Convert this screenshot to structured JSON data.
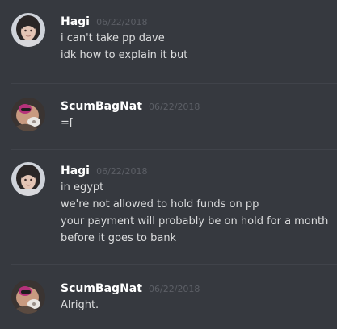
{
  "colors": {
    "background": "#36393f",
    "username": "#ffffff",
    "message_text": "#dcddde",
    "timestamp": "#5c5f66",
    "divider": "#40434a"
  },
  "messages": [
    {
      "username": "Hagi",
      "timestamp": "06/22/2018",
      "avatar": "hagi-avatar",
      "lines": [
        "i can't take pp dave",
        "idk how to explain it but"
      ]
    },
    {
      "username": "ScumBagNat",
      "timestamp": "06/22/2018",
      "avatar": "scumbagnat-avatar",
      "lines": [
        "=["
      ]
    },
    {
      "username": "Hagi",
      "timestamp": "06/22/2018",
      "avatar": "hagi-avatar",
      "lines": [
        "in egypt",
        "we're not allowed to hold funds on pp",
        "your payment will probably be on hold for a month",
        "before it goes to bank"
      ]
    },
    {
      "username": "ScumBagNat",
      "timestamp": "06/22/2018",
      "avatar": "scumbagnat-avatar",
      "lines": [
        "Alright."
      ]
    }
  ]
}
